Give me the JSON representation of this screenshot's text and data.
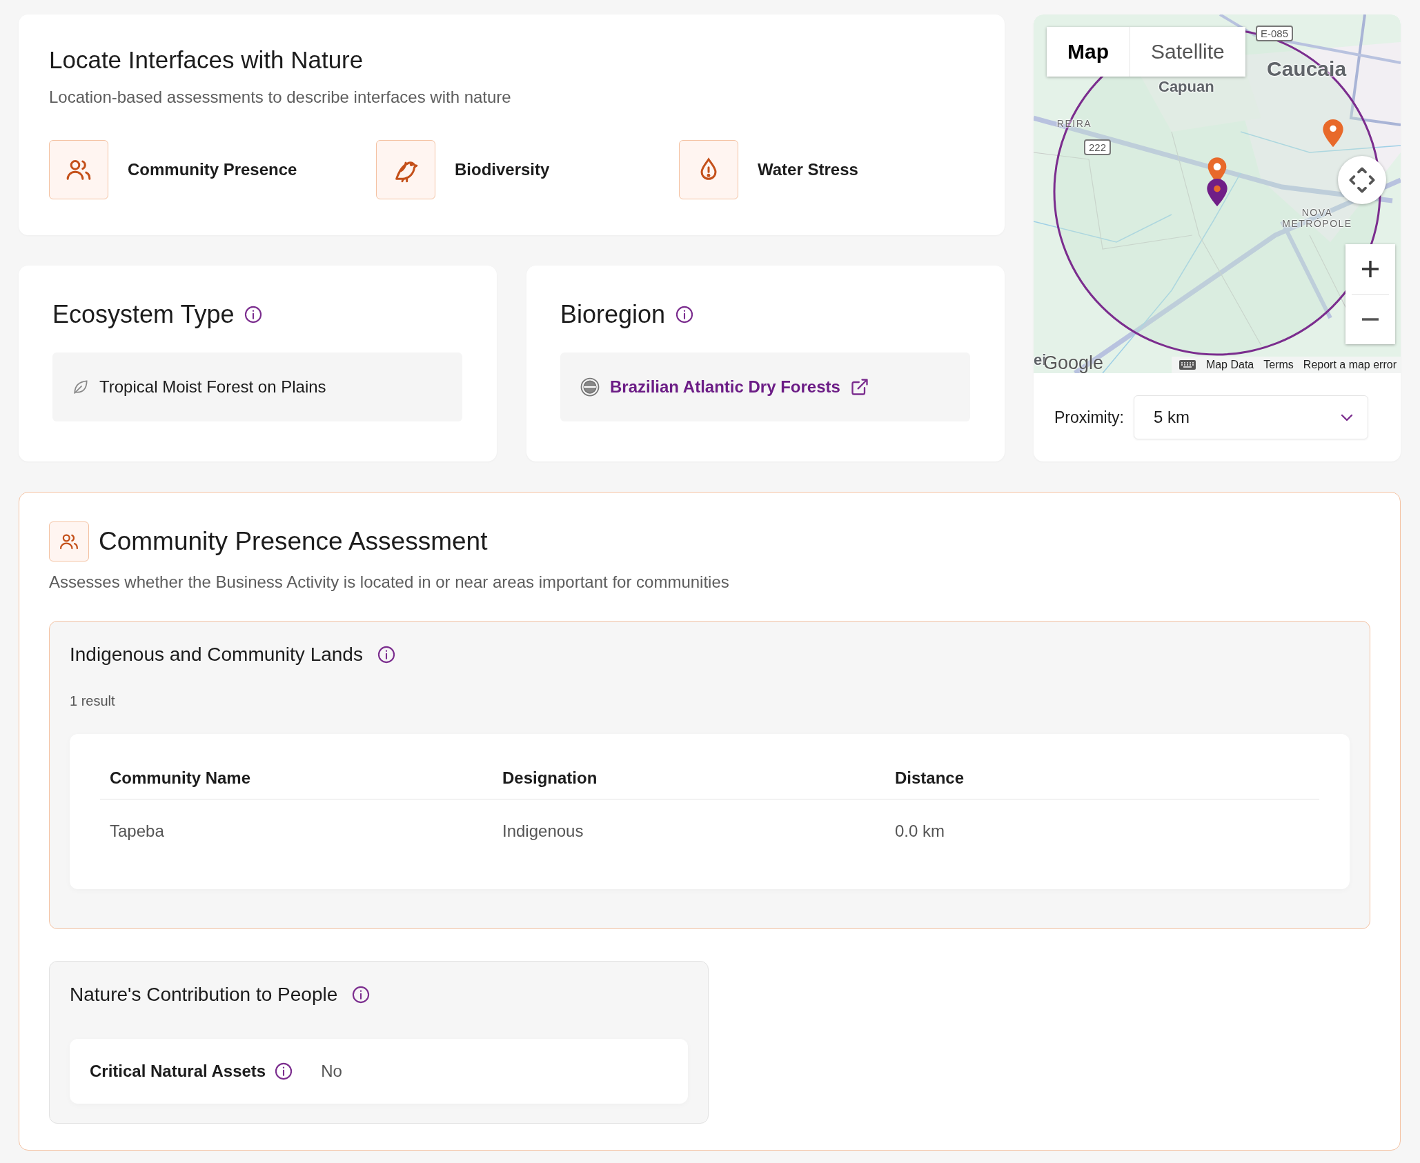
{
  "overview": {
    "title": "Locate Interfaces with Nature",
    "subtitle": "Location-based assessments to describe interfaces with nature",
    "categories": [
      {
        "label": "Community Presence",
        "kind": "people"
      },
      {
        "label": "Biodiversity",
        "kind": "bird"
      },
      {
        "label": "Water Stress",
        "kind": "drop"
      }
    ]
  },
  "ecosystem_type": {
    "title": "Ecosystem Type",
    "value": "Tropical Moist Forest on Plains"
  },
  "bioregion": {
    "title": "Bioregion",
    "value": "Brazilian Atlantic Dry Forests"
  },
  "map": {
    "tabs": [
      {
        "label": "Map",
        "selected": true
      },
      {
        "label": "Satellite",
        "selected": false
      }
    ],
    "labels": [
      {
        "text": "E-085",
        "kind": "route"
      },
      {
        "text": "Caucaia",
        "kind": "city"
      },
      {
        "text": "Capuan",
        "kind": "town"
      },
      {
        "text": "REIRA",
        "kind": "district"
      },
      {
        "text": "222",
        "kind": "route"
      },
      {
        "text": "NOVA METRÓPOLE",
        "kind": "district"
      },
      {
        "text": "ei",
        "kind": "town"
      }
    ],
    "logo": "Google",
    "attribution": [
      "Map Data",
      "Terms",
      "Report a map error"
    ]
  },
  "proximity": {
    "label": "Proximity:",
    "value": "5 km"
  },
  "assessment": {
    "title": "Community Presence Assessment",
    "description": "Assesses whether the Business Activity is located in or near areas important for communities",
    "sections": [
      {
        "kind": "table",
        "title": "Indigenous and Community Lands",
        "count": "1 result",
        "columns": [
          "Community Name",
          "Designation",
          "Distance"
        ],
        "rows": [
          [
            "Tapeba",
            "Indigenous",
            "0.0 km"
          ]
        ]
      },
      {
        "kind": "attributes",
        "title": "Nature's Contribution to People",
        "items": [
          {
            "label": "Critical Natural Assets",
            "value": "No"
          }
        ]
      }
    ]
  }
}
